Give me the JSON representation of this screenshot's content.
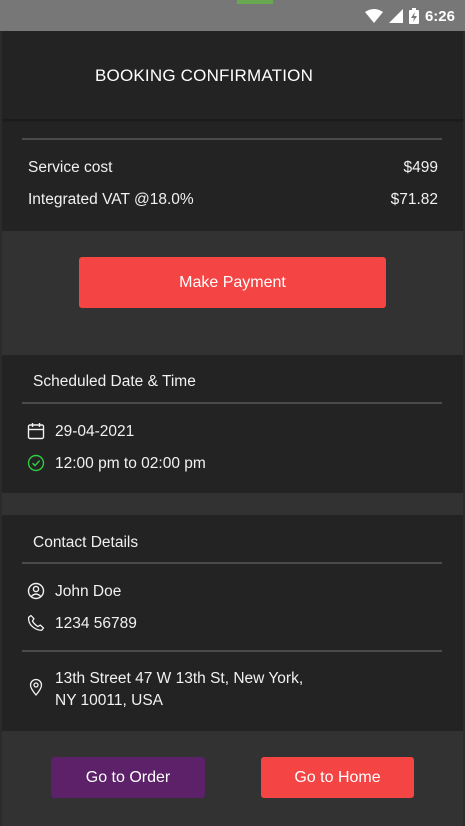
{
  "status_bar": {
    "time": "6:26",
    "icons": [
      "wifi-icon",
      "signal-icon",
      "battery-charging-icon"
    ]
  },
  "header": {
    "title": "BOOKING CONFIRMATION"
  },
  "cost": {
    "service_label": "Service cost",
    "service_value": "$499",
    "vat_label": "Integrated VAT @18.0%",
    "vat_value": "$71.82"
  },
  "payment": {
    "button_label": "Make Payment"
  },
  "schedule": {
    "title": "Scheduled Date & Time",
    "date": "29-04-2021",
    "time_slot": "12:00 pm to 02:00 pm"
  },
  "contact": {
    "title": "Contact Details",
    "name": "John Doe",
    "phone": "1234 56789",
    "address_line1": "13th Street 47 W 13th St, New York,",
    "address_line2": "NY 10011, USA"
  },
  "footer": {
    "order_label": "Go to Order",
    "home_label": "Go to Home"
  },
  "colors": {
    "accent_red": "#f44444",
    "order_purple": "#5c2168",
    "check_green": "#2ecc40",
    "background": "#212121"
  }
}
